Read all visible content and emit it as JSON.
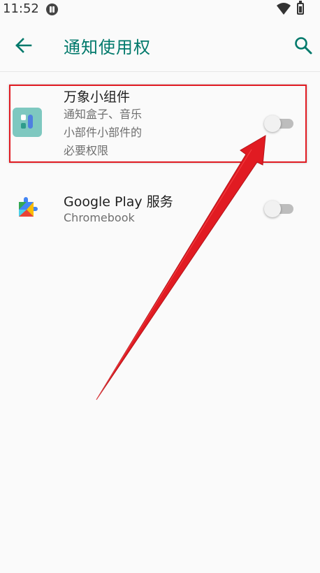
{
  "status_bar": {
    "time": "11:52",
    "icons": [
      "app-notification-icon",
      "wifi-icon",
      "battery-icon"
    ]
  },
  "app_bar": {
    "title": "通知使用权",
    "back_icon": "arrow-back-icon",
    "search_icon": "search-icon",
    "accent_color": "#00796b"
  },
  "apps": [
    {
      "name": "万象小组件",
      "summary_lines": [
        "通知盒子、音乐",
        "小部件小部件的",
        "必要权限"
      ],
      "enabled": false,
      "icon": "widget-app-icon"
    },
    {
      "name": "Google Play 服务",
      "summary_lines": [
        "Chromebook"
      ],
      "enabled": false,
      "icon": "google-play-services-icon"
    }
  ],
  "annotation": {
    "color": "#e11b22",
    "shapes": [
      "highlight-box",
      "arrow"
    ]
  }
}
